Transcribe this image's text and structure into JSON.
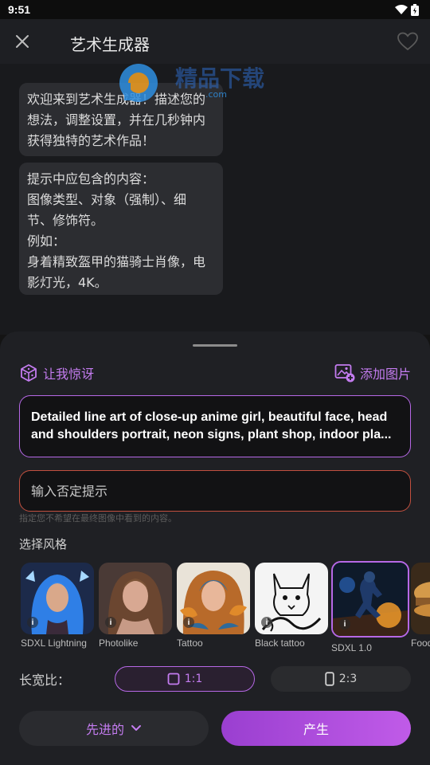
{
  "status_bar": {
    "time": "9:51"
  },
  "header": {
    "title": "艺术生成器"
  },
  "chat": {
    "messages": [
      {
        "lines": [
          "欢迎来到艺术生成器！描述您的",
          "想法，调整设置，并在几秒钟内",
          "获得独特的艺术作品！"
        ]
      },
      {
        "lines": [
          "提示中应包含的内容：",
          "图像类型、对象（强制）、细",
          "节、修饰符。",
          "例如：",
          "身着精致盔甲的猫骑士肖像，电",
          "影灯光，4K。"
        ]
      }
    ]
  },
  "watermark": {
    "text": "精品下载",
    "domain": ".com"
  },
  "panel": {
    "surprise_label": "让我惊讶",
    "add_image_label": "添加图片",
    "prompt": {
      "lines": [
        "Detailed line art of close-up anime girl, beautiful face, head",
        "and shoulders portrait, neon signs, plant shop, indoor pla..."
      ]
    },
    "negative": {
      "placeholder": "输入否定提示",
      "value": "",
      "hint": "指定您不希望在最终图像中看到的内容。"
    },
    "style_heading": "选择风格",
    "styles": [
      {
        "name": "SDXL Lightning",
        "selected": false
      },
      {
        "name": "Photolike",
        "selected": false
      },
      {
        "name": "Tattoo",
        "selected": false
      },
      {
        "name": "Black tattoo",
        "selected": false
      },
      {
        "name": "SDXL 1.0",
        "selected": true
      },
      {
        "name": "Food",
        "selected": false
      }
    ],
    "aspect_heading": "长宽比：",
    "aspect_options": [
      {
        "label": "1:1",
        "selected": true
      },
      {
        "label": "2:3",
        "selected": false
      }
    ],
    "advanced_label": "先进的",
    "generate_label": "产生"
  },
  "colors": {
    "accent": "#c47cf0",
    "accent_border": "#b668e6",
    "error_border": "#c2503f",
    "background": "#141414",
    "sheet": "#1f2024"
  }
}
